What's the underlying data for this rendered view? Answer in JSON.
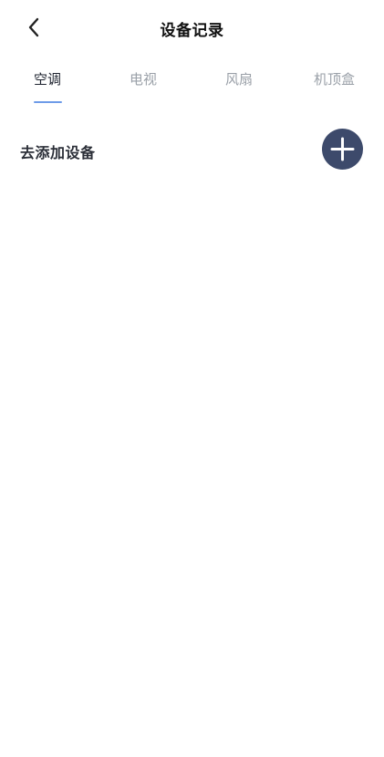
{
  "header": {
    "title": "设备记录",
    "back_icon": "chevron-left-icon"
  },
  "tabs": [
    {
      "label": "空调",
      "active": true
    },
    {
      "label": "电视",
      "active": false
    },
    {
      "label": "风扇",
      "active": false
    },
    {
      "label": "机顶盒",
      "active": false
    }
  ],
  "add_device": {
    "label": "去添加设备",
    "button_icon": "plus-icon"
  },
  "colors": {
    "accent_underline": "#6e9be8",
    "add_button_bg": "#3d4a6b",
    "active_tab": "#1f2430",
    "inactive_tab": "#9aa0a8"
  }
}
